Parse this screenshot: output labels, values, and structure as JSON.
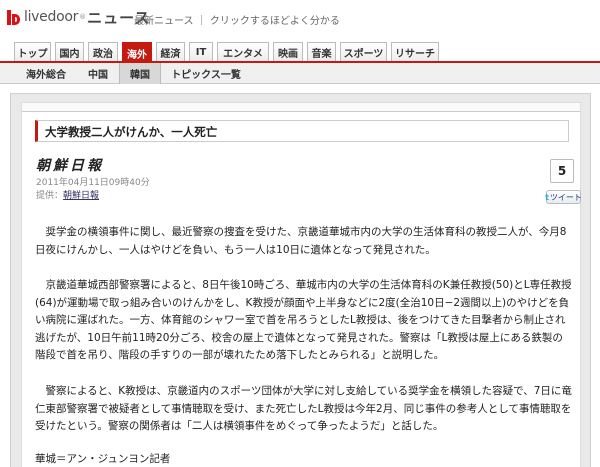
{
  "header": {
    "logo_text": "livedoor",
    "logo_sup": "®",
    "logo_news": "ニュース",
    "tagline": "最新ニュース ｜ クリックするほどよく分かる"
  },
  "tabs": [
    {
      "label": "トップ"
    },
    {
      "label": "国内"
    },
    {
      "label": "政治"
    },
    {
      "label": "海外"
    },
    {
      "label": "経済"
    },
    {
      "label": "IT"
    },
    {
      "label": "エンタメ"
    },
    {
      "label": "映画"
    },
    {
      "label": "音楽"
    },
    {
      "label": "スポーツ"
    },
    {
      "label": "リサーチ"
    }
  ],
  "active_tab": "海外",
  "subnav": [
    {
      "label": "海外総合"
    },
    {
      "label": "中国"
    },
    {
      "label": "韓国"
    },
    {
      "label": "トピックス一覧"
    }
  ],
  "active_subtab": "韓国",
  "article": {
    "title": "大学教授二人がけんか、一人死亡",
    "source_logo": "朝鮮日報",
    "date": "2011年04月11日09時40分",
    "provider_label": "提供：",
    "provider_name": "朝鮮日報",
    "share_count": "5",
    "tweet_label": "ツイート",
    "paragraphs": [
      "奨学金の横領事件に関し、最近警察の捜査を受けた、京畿道華城市内の大学の生活体育科の教授二人が、今月8日夜にけんかし、一人はやけどを負い、もう一人は10日に遺体となって発見された。",
      "京畿道華城西部警察署によると、8日午後10時ごろ、華城市内の大学の生活体育科のK兼任教授(50)とL専任教授(64)が運動場で取っ組み合いのけんかをし、K教授が顔面や上半身などに2度(全治10日−2週間以上)のやけどを負い病院に運ばれた。一方、体育館のシャワー室で首を吊ろうとしたL教授は、後をつけてきた目撃者から制止され逃げたが、10日午前11時20分ごろ、校舎の屋上で遺体となって発見された。警察は「L教授は屋上にある鉄製の階段で首を吊り、階段の手すりの一部が壊れたため落下したとみられる」と説明した。",
      "警察によると、K教授は、京畿道内のスポーツ団体が大学に対し支給している奨学金を横領した容疑で、7日に竜仁東部警察署で被疑者として事情聴取を受け、また死亡したL教授は今年2月、同じ事件の参考人として事情聴取を受けたという。警察の関係者は「二人は横領事件をめぐって争ったようだ」と話した。"
    ],
    "byline": "華城＝アン・ジュンヨン記者"
  },
  "colors": {
    "brand_red": "#c41a10",
    "twitter_blue": "#2aa3df"
  }
}
